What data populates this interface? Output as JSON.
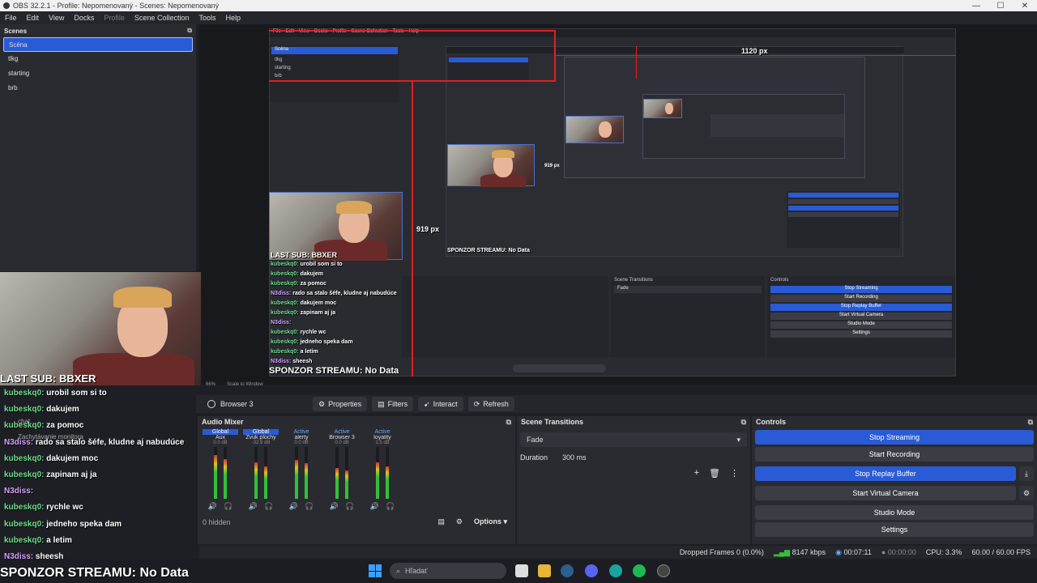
{
  "window": {
    "title": "OBS 32.2.1 - Profile: Nepomenovaný - Scenes: Nepomenovaný",
    "min": "—",
    "max": "☐",
    "close": "✕"
  },
  "menu": [
    "File",
    "Edit",
    "View",
    "Docks",
    "Profile",
    "Scene Collection",
    "Tools",
    "Help"
  ],
  "scenes": {
    "title": "Scenes",
    "items": [
      "Scéna",
      "tlkg",
      "starting",
      "brb"
    ],
    "selected": "Scéna"
  },
  "preview": {
    "measure_w": "1120 px",
    "measure_h": "919 px",
    "nested_label_h": "919 px",
    "last_sub": "LAST SUB: BBXER",
    "sponsor": "SPONZOR STREAMU: No Data",
    "zoom": "66%",
    "scale": "Scale to Window",
    "overlay_chat": "chat",
    "overlay_monitor": "Zachytávanie monitora"
  },
  "chat": [
    {
      "user": "kubeskq0:",
      "msg": "urobil som si to",
      "purple": false
    },
    {
      "user": "kubeskq0:",
      "msg": "dakujem",
      "purple": false
    },
    {
      "user": "kubeskq0:",
      "msg": "za pomoc",
      "purple": false
    },
    {
      "user": "N3diss:",
      "msg": "rado sa stalo šéfe, kludne aj nabudúce",
      "purple": true
    },
    {
      "user": "kubeskq0:",
      "msg": "dakujem moc",
      "purple": false
    },
    {
      "user": "kubeskq0:",
      "msg": "zapinam aj ja",
      "purple": false
    },
    {
      "user": "N3diss:",
      "msg": "",
      "purple": true
    },
    {
      "user": "kubeskq0:",
      "msg": "rychle wc",
      "purple": false
    },
    {
      "user": "kubeskq0:",
      "msg": "jedneho speka dam",
      "purple": false
    },
    {
      "user": "kubeskq0:",
      "msg": "a letim",
      "purple": false
    },
    {
      "user": "N3diss:",
      "msg": "sheesh",
      "purple": true
    }
  ],
  "source_toolbar": {
    "source": "Browser 3",
    "properties": "Properties",
    "filters": "Filters",
    "interact": "Interact",
    "refresh": "Refresh"
  },
  "audio_mixer": {
    "title": "Audio Mixer",
    "channels": [
      {
        "tag": "Global",
        "name": "Aux",
        "db": "0.0 dB",
        "level": 0.85
      },
      {
        "tag": "Global",
        "name": "Zvuk plochy",
        "db": "-32.9 dB",
        "level": 0.7
      },
      {
        "tag": "Active",
        "name": "alerty",
        "db": "0.0 dB",
        "level": 0.75
      },
      {
        "tag": "Active",
        "name": "Browser 3",
        "db": "0.0 dB",
        "level": 0.6
      },
      {
        "tag": "Active",
        "name": "loyality",
        "db": "1.5 dB",
        "level": 0.7
      }
    ],
    "hidden": "0 hidden",
    "options": "Options"
  },
  "scene_transitions": {
    "title": "Scene Transitions",
    "transition": "Fade",
    "duration_label": "Duration",
    "duration": "300 ms"
  },
  "controls": {
    "title": "Controls",
    "buttons": [
      "Stop Streaming",
      "Start Recording",
      "Stop Replay Buffer",
      "Start Virtual Camera",
      "Studio Mode",
      "Settings"
    ]
  },
  "status": {
    "dropped": "Dropped Frames 0 (0.0%)",
    "kbps": "8147 kbps",
    "stream_time": "00:07:11",
    "rec_time": "00:00:00",
    "cpu": "CPU: 3.3%",
    "fps": "60.00 / 60.00 FPS"
  },
  "taskbar": {
    "search": "Hľadať"
  }
}
